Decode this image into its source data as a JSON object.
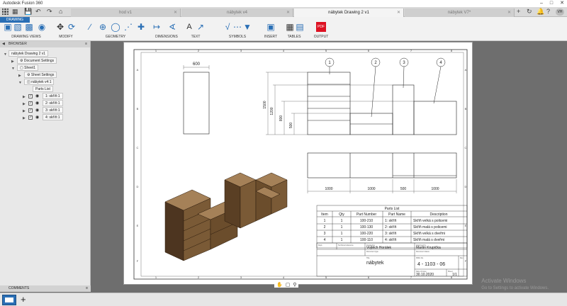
{
  "app": {
    "title": "Autodesk Fusion 360",
    "tabs": [
      {
        "label": "hod v1",
        "active": false
      },
      {
        "label": "nábytek v4",
        "active": false
      },
      {
        "label": "nábytek Drawing 2 v1",
        "active": true
      },
      {
        "label": "nábytek V7*",
        "active": false
      }
    ]
  },
  "ribbon": {
    "workspace": "DRAWING",
    "groups": [
      "DRAWING VIEWS",
      "MODIFY",
      "GEOMETRY",
      "DIMENSIONS",
      "TEXT",
      "SYMBOLS",
      "INSERT",
      "TABLES",
      "OUTPUT"
    ]
  },
  "browser": {
    "title": "BROWSER",
    "root": "nábytek Drawing 2 v1",
    "document_settings": "Document Settings",
    "sheet": "Sheet1",
    "sheet_settings": "Sheet Settings",
    "model": "nábytek v4:1",
    "parts_list": "Parts List",
    "parts": [
      "1: skříň:1",
      "2: skříň:1",
      "3: skříň:1",
      "4: skříň:1"
    ],
    "comments": "COMMENTS"
  },
  "drawing": {
    "grid_cols": [
      "1",
      "2",
      "3",
      "4",
      "5",
      "6",
      "7",
      "8"
    ],
    "grid_rows": [
      "A",
      "B",
      "C",
      "D",
      "E",
      "F"
    ],
    "dims": {
      "top_width": "600",
      "h1500": "1500",
      "h1200": "1200",
      "h800": "800",
      "h500": "500",
      "w1": "1000",
      "w2": "1000",
      "w3": "500",
      "w4": "1000"
    },
    "balloons": [
      "1",
      "2",
      "3",
      "4"
    ],
    "parts_list": {
      "title": "Parts List",
      "headers": [
        "Item",
        "Qty",
        "Part Number",
        "Part Name",
        "Description"
      ],
      "rows": [
        [
          "1",
          "1",
          "100-210",
          "1: skříň",
          "Skříň velká s policemi"
        ],
        [
          "2",
          "1",
          "100-130",
          "2: skříň",
          "Skříň malá s policemi"
        ],
        [
          "3",
          "1",
          "100-220",
          "3: skříň",
          "Skříň velká s dveřmi"
        ],
        [
          "4",
          "1",
          "100-110",
          "4: skříň",
          "Skříň malá s dveřmi"
        ]
      ]
    },
    "title_block": {
      "dept_label": "Dept.",
      "tech_ref_label": "Technical reference",
      "created_by_label": "Created by",
      "created_by": "Vojtěch Horálek",
      "approved_by_label": "Approved by",
      "approved_by": "Martin Krupička",
      "doc_type_label": "Document type",
      "doc_status_label": "Document status",
      "title_label": "Title",
      "title": "nábytek",
      "dwg_no_label": "DWG No.",
      "dwg_no": "4 - 1103 - 06",
      "rev_label": "Rev.",
      "date_label": "Date of issue",
      "date": "30.10.2020",
      "sheet_label": "Sheet",
      "sheet": "1/1"
    }
  },
  "watermark": {
    "line1": "Activate Windows",
    "line2": "Go to Settings to activate Windows."
  },
  "colors": {
    "accent": "#2a6fb5",
    "wood": "#7a5a36",
    "wood_dark": "#4d3520",
    "wood_light": "#a58158"
  }
}
